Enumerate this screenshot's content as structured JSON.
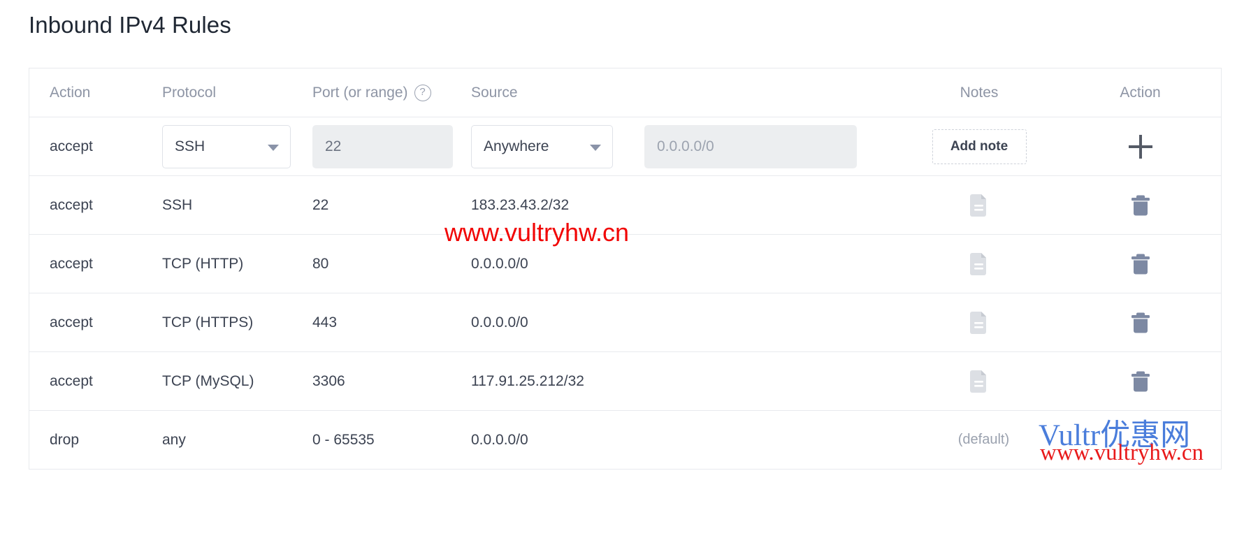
{
  "page": {
    "title": "Inbound IPv4 Rules"
  },
  "table": {
    "headers": {
      "action": "Action",
      "protocol": "Protocol",
      "port": "Port (or range)",
      "port_help_icon": "help-circle-icon",
      "source": "Source",
      "notes": "Notes",
      "action2": "Action"
    },
    "new_rule_row": {
      "action": "accept",
      "protocol_select": {
        "value": "SSH",
        "caret_icon": "chevron-down-icon"
      },
      "port_input": {
        "value": "22"
      },
      "source_select": {
        "value": "Anywhere",
        "caret_icon": "chevron-down-icon"
      },
      "cidr_input": {
        "value": "0.0.0.0/0"
      },
      "add_note_label": "Add note",
      "add_button_icon": "plus-icon"
    },
    "rows": [
      {
        "action": "accept",
        "protocol": "SSH",
        "port": "22",
        "source": "183.23.43.2/32",
        "default_tag": "",
        "note_icon": "note-document-icon",
        "delete_icon": "trash-icon"
      },
      {
        "action": "accept",
        "protocol": "TCP (HTTP)",
        "port": "80",
        "source": "0.0.0.0/0",
        "default_tag": "",
        "note_icon": "note-document-icon",
        "delete_icon": "trash-icon"
      },
      {
        "action": "accept",
        "protocol": "TCP (HTTPS)",
        "port": "443",
        "source": "0.0.0.0/0",
        "default_tag": "",
        "note_icon": "note-document-icon",
        "delete_icon": "trash-icon"
      },
      {
        "action": "accept",
        "protocol": "TCP (MySQL)",
        "port": "3306",
        "source": "117.91.25.212/32",
        "default_tag": "",
        "note_icon": "note-document-icon",
        "delete_icon": "trash-icon"
      },
      {
        "action": "drop",
        "protocol": "any",
        "port": "0 - 65535",
        "source": "0.0.0.0/0",
        "default_tag": "(default)",
        "note_icon": "",
        "delete_icon": ""
      }
    ]
  },
  "watermarks": {
    "center": "www.vultryhw.cn",
    "bottom_brand": "Vultr优惠网",
    "bottom_url": "www.vultryhw.cn"
  },
  "colors": {
    "title": "#1f2733",
    "header_text": "#8e95a5",
    "body_text": "#3c4352",
    "muted": "#9aa1ae",
    "border": "#e8eaee",
    "input_bg": "#eceef0",
    "trash": "#7d89a3",
    "note": "#dcdfe4",
    "watermark_red": "#f10505",
    "watermark_blue": "#4a7ddb"
  }
}
